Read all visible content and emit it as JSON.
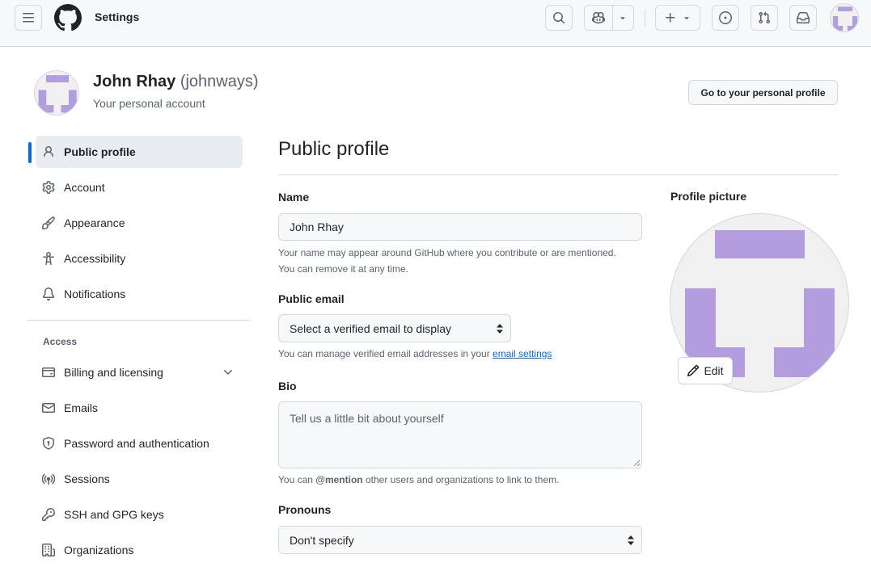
{
  "header": {
    "title": "Settings",
    "menu_icon": "hamburger-icon",
    "logo_icon": "github-mark-icon",
    "search_icon": "search-icon",
    "copilot_icon": "copilot-icon",
    "create_icon": "plus-icon",
    "issues_icon": "issue-opened-icon",
    "pulls_icon": "git-pull-request-icon",
    "inbox_icon": "inbox-icon"
  },
  "account": {
    "display_name": "John Rhay",
    "login": "(johnways)",
    "subtitle": "Your personal account",
    "profile_button": "Go to your personal profile"
  },
  "sidebar": {
    "items": [
      {
        "label": "Public profile",
        "icon": "person-icon",
        "active": true
      },
      {
        "label": "Account",
        "icon": "gear-icon"
      },
      {
        "label": "Appearance",
        "icon": "paintbrush-icon"
      },
      {
        "label": "Accessibility",
        "icon": "accessibility-icon"
      },
      {
        "label": "Notifications",
        "icon": "bell-icon"
      }
    ],
    "access_heading": "Access",
    "access_items": [
      {
        "label": "Billing and licensing",
        "icon": "credit-card-icon",
        "expandable": true
      },
      {
        "label": "Emails",
        "icon": "mail-icon"
      },
      {
        "label": "Password and authentication",
        "icon": "shield-lock-icon"
      },
      {
        "label": "Sessions",
        "icon": "broadcast-icon"
      },
      {
        "label": "SSH and GPG keys",
        "icon": "key-icon"
      },
      {
        "label": "Organizations",
        "icon": "organization-icon"
      }
    ]
  },
  "main": {
    "title": "Public profile",
    "name": {
      "label": "Name",
      "value": "John Rhay",
      "note": "Your name may appear around GitHub where you contribute or are mentioned. You can remove it at any time."
    },
    "public_email": {
      "label": "Public email",
      "selected": "Select a verified email to display",
      "note_prefix": "You can manage verified email addresses in your ",
      "note_link": "email settings"
    },
    "bio": {
      "label": "Bio",
      "placeholder": "Tell us a little bit about yourself",
      "note_prefix": "You can ",
      "note_mention": "@mention",
      "note_suffix": " other users and organizations to link to them."
    },
    "pronouns": {
      "label": "Pronouns",
      "selected": "Don't specify"
    }
  },
  "profile_picture": {
    "label": "Profile picture",
    "edit_button": "Edit"
  },
  "colors": {
    "accent": "#0969da",
    "avatar_fill": "#b39ddf",
    "avatar_bg": "#f0f0f0",
    "border": "#d1d9e0",
    "muted_text": "#59636e"
  }
}
